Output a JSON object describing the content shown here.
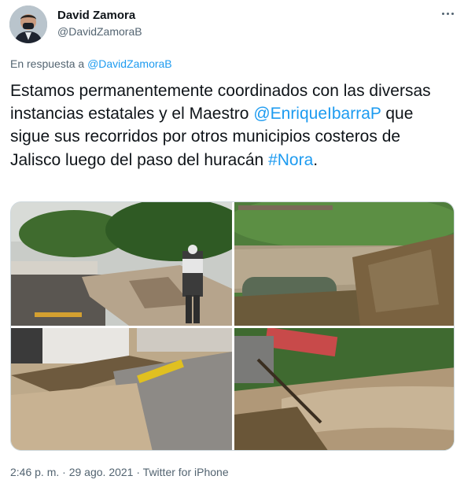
{
  "author": {
    "name": "David Zamora",
    "handle": "@DavidZamoraB"
  },
  "reply": {
    "prefix": "En respuesta a",
    "to": "@DavidZamoraB"
  },
  "tweet": {
    "text_part1": "Estamos permanentemente coordinados con las diversas instancias estatales y el Maestro ",
    "mention": "@EnriqueIbarraP",
    "text_part2": " que sigue sus recorridos por otros municipios costeros de Jalisco luego del paso del huracán ",
    "hashtag": "#Nora",
    "text_part3": "."
  },
  "meta": {
    "time": "2:46 p. m.",
    "separator1": " · ",
    "date": "29 ago. 2021",
    "separator2": " · ",
    "source": "Twitter for iPhone"
  },
  "icons": {
    "more": "more-options-icon"
  },
  "colors": {
    "link": "#1d9bf0",
    "secondary_text": "#536471",
    "primary_text": "#0f1419"
  }
}
